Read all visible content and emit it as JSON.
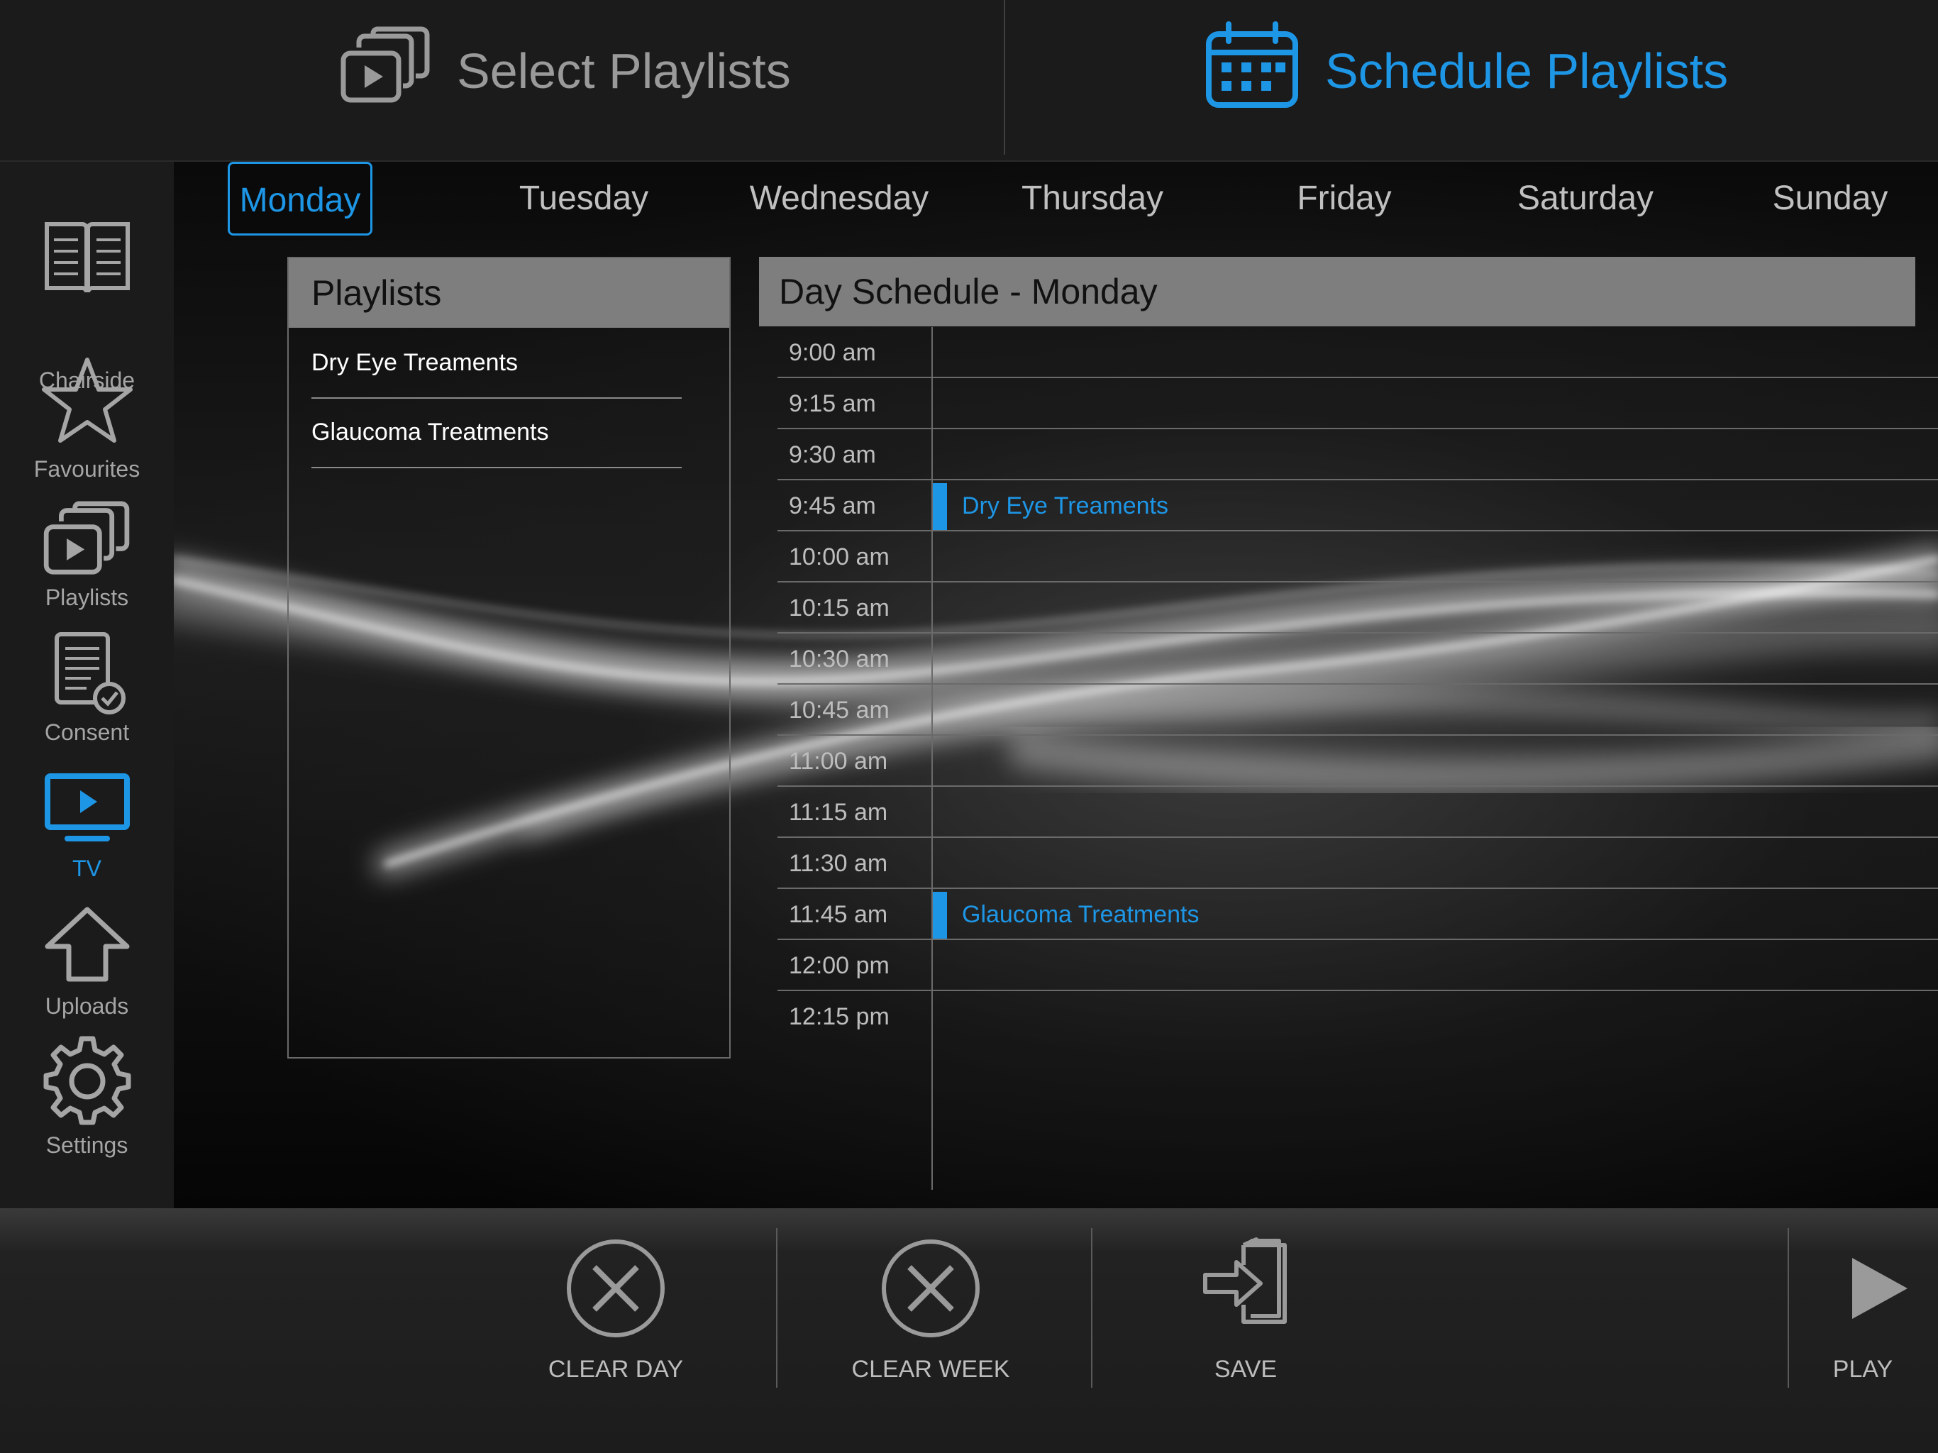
{
  "colors": {
    "accent": "#1e96e6",
    "header_gray": "#7e7e7e",
    "bar_bg": "#1b1b1b"
  },
  "header": {
    "tabs": [
      {
        "label": "Select Playlists",
        "icon": "playlist-stack-icon",
        "active": false
      },
      {
        "label": "Schedule Playlists",
        "icon": "calendar-icon",
        "active": true
      }
    ]
  },
  "sidebar": {
    "items": [
      {
        "label": "Chairside",
        "icon": "book-icon",
        "active": false
      },
      {
        "label": "Favourites",
        "icon": "star-icon",
        "active": false
      },
      {
        "label": "Playlists",
        "icon": "playlist-stack-icon",
        "active": false
      },
      {
        "label": "Consent",
        "icon": "document-check-icon",
        "active": false
      },
      {
        "label": "TV",
        "icon": "tv-icon",
        "active": true
      },
      {
        "label": "Uploads",
        "icon": "upload-arrow-icon",
        "active": false
      },
      {
        "label": "Settings",
        "icon": "gear-icon",
        "active": false
      }
    ]
  },
  "days": {
    "items": [
      "Monday",
      "Tuesday",
      "Wednesday",
      "Thursday",
      "Friday",
      "Saturday",
      "Sunday"
    ],
    "selected": "Monday"
  },
  "playlists": {
    "title": "Playlists",
    "items": [
      "Dry Eye Treaments",
      "Glaucoma Treatments"
    ]
  },
  "schedule": {
    "title": "Day Schedule - Monday",
    "slots": [
      {
        "time": "9:00 am",
        "entry": ""
      },
      {
        "time": "9:15 am",
        "entry": ""
      },
      {
        "time": "9:30 am",
        "entry": ""
      },
      {
        "time": "9:45 am",
        "entry": "Dry Eye Treaments"
      },
      {
        "time": "10:00 am",
        "entry": ""
      },
      {
        "time": "10:15 am",
        "entry": ""
      },
      {
        "time": "10:30 am",
        "entry": ""
      },
      {
        "time": "10:45 am",
        "entry": ""
      },
      {
        "time": "11:00 am",
        "entry": ""
      },
      {
        "time": "11:15 am",
        "entry": ""
      },
      {
        "time": "11:30 am",
        "entry": ""
      },
      {
        "time": "11:45 am",
        "entry": "Glaucoma Treatments"
      },
      {
        "time": "12:00 pm",
        "entry": ""
      },
      {
        "time": "12:15 pm",
        "entry": ""
      }
    ]
  },
  "toolbar": {
    "clear_day": "CLEAR DAY",
    "clear_week": "CLEAR WEEK",
    "save": "SAVE",
    "play": "PLAY"
  }
}
